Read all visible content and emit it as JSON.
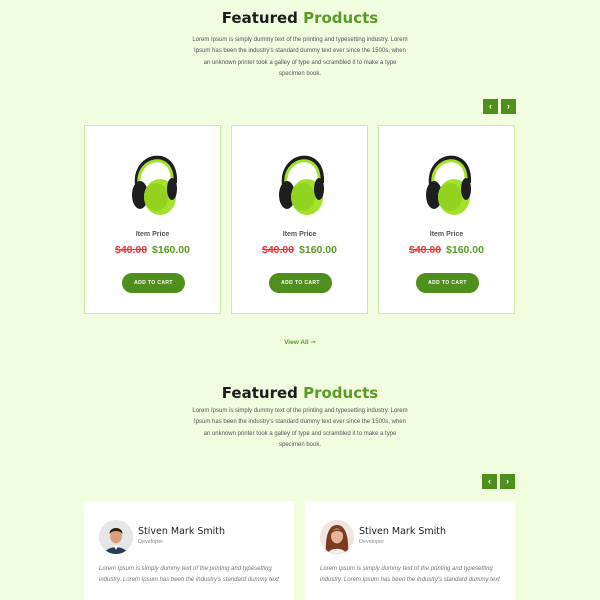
{
  "section1": {
    "title_main": "Featured",
    "title_accent": "Products",
    "description": "Lorem Ipsum is simply dummy text of the printing and typesetting industry. Lorem Ipsum has been the industry's standard dummy text ever since the 1500s, when an unknown printer took a galley of type and scrambled it to make a type specimen book.",
    "prev_icon": "‹",
    "next_icon": "›",
    "products": [
      {
        "label": "Item Price",
        "old_price": "$40.00",
        "new_price": "$160.00",
        "button": "ADD TO CART",
        "image": "green-headphones"
      },
      {
        "label": "Item Price",
        "old_price": "$40.00",
        "new_price": "$160.00",
        "button": "ADD TO CART",
        "image": "green-headphones"
      },
      {
        "label": "Item Price",
        "old_price": "$40.00",
        "new_price": "$160.00",
        "button": "ADD TO CART",
        "image": "green-headphones"
      }
    ],
    "view_all": "View All ➞"
  },
  "section2": {
    "title_main": "Featured",
    "title_accent": "Products",
    "description": "Lorem Ipsum is simply dummy text of the printing and typesetting industry. Lorem Ipsum has been the industry's standard dummy text ever since the 1500s, when an unknown printer took a galley of type and scrambled it to make a type specimen book.",
    "prev_icon": "‹",
    "next_icon": "›",
    "testimonials": [
      {
        "name": "Stiven Mark Smith",
        "role": "Developer",
        "text": "Lorem Ipsum is simply dummy text of the printing and typesetting industry. Lorem Ipsum has been the industry's standard dummy text",
        "avatar": "man-avatar"
      },
      {
        "name": "Stiven Mark Smith",
        "role": "Developer",
        "text": "Lorem Ipsum is simply dummy text of the printing and typesetting industry. Lorem Ipsum has been the industry's standard dummy text",
        "avatar": "woman-avatar"
      }
    ]
  },
  "colors": {
    "background": "#f0fddf",
    "accent": "#5a9b26",
    "button": "#4f8f1d",
    "old_price": "#e8373b",
    "headphone": "#a3e22b"
  }
}
